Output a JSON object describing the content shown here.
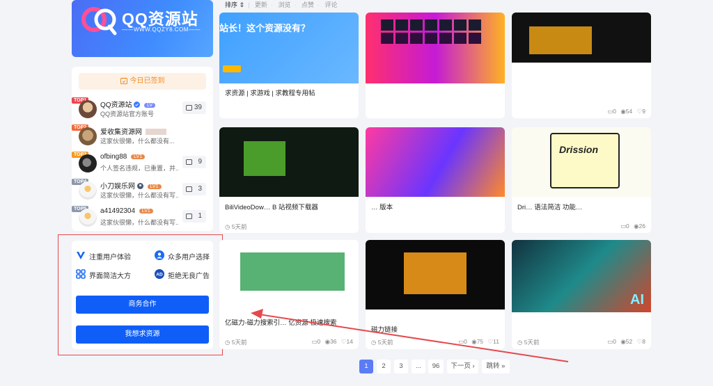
{
  "logo": {
    "title": "QQ资源站",
    "subtitle": "WWW.QQZY8.COM"
  },
  "signin": {
    "label": "今日已签到"
  },
  "users": [
    {
      "rank": "TOP1",
      "name": "QQ资源站",
      "level": "LV",
      "desc": "QQ资源站官方账号",
      "count": "39",
      "rank_color": "#f0444f"
    },
    {
      "rank": "TOP2",
      "name": "爱收集资源网",
      "level": "",
      "desc": "这家伙很懒，什么都没有...",
      "count": "",
      "rank_color": "#f26b3a"
    },
    {
      "rank": "TOP3",
      "name": "ofbing88",
      "level": "LV1",
      "desc": "个人签名违规，已重置，并...",
      "count": "9",
      "rank_color": "#f59a23"
    },
    {
      "rank": "TOP4",
      "name": "小刀娱乐网",
      "level": "LV1",
      "desc": "这家伙很懒，什么都没有写...",
      "count": "3",
      "rank_color": "#8e98ab"
    },
    {
      "rank": "TOP5",
      "name": "a41492304",
      "level": "LV1",
      "desc": "这家伙很懒，什么都没有写...",
      "count": "1",
      "rank_color": "#8e98ab"
    }
  ],
  "features": {
    "items": [
      "注重用户体验",
      "众多用户选择",
      "界面简洁大方",
      "拒绝无良广告"
    ],
    "business_btn": "商务合作",
    "request_btn": "我想求资源"
  },
  "sortbar": {
    "label": "排序",
    "options": [
      "更新",
      "浏览",
      "点赞",
      "评论"
    ]
  },
  "cards": [
    {
      "title": "求资源 | 求游戏 | 求教程专用帖",
      "time": "",
      "comments": "",
      "views": "",
      "likes": "",
      "thumb_text": "站长！这个资源没有？"
    },
    {
      "title": "",
      "time": "",
      "comments": "",
      "views": "",
      "likes": "",
      "thumb_text": ""
    },
    {
      "title": "",
      "time": "",
      "comments": "0",
      "views": "54",
      "likes": "9",
      "thumb_text": ""
    },
    {
      "title": "BiliVideoDow… B 站视频下载器",
      "time": "5天前",
      "comments": "",
      "views": "",
      "likes": "",
      "thumb_text": ""
    },
    {
      "title": "… 版本",
      "time": "",
      "comments": "",
      "views": "",
      "likes": "",
      "thumb_text": ""
    },
    {
      "title": "Dri… 语法简洁 功能…",
      "time": "",
      "comments": "0",
      "views": "26",
      "likes": "",
      "thumb_text": "Drission"
    },
    {
      "title": "亿磁力-磁力搜索引… 亿资源 极速搜索",
      "time": "5天前",
      "comments": "0",
      "views": "36",
      "likes": "14",
      "thumb_text": ""
    },
    {
      "title": "磁力链接",
      "time": "5天前",
      "comments": "0",
      "views": "75",
      "likes": "11",
      "thumb_text": ""
    },
    {
      "title": "",
      "time": "5天前",
      "comments": "0",
      "views": "52",
      "likes": "8",
      "thumb_text": ""
    }
  ],
  "pagination": {
    "pages": [
      "1",
      "2",
      "3",
      "...",
      "96"
    ],
    "next": "下一页",
    "jump": "跳转"
  },
  "colors": {
    "accent": "#0f5ef7",
    "page_active": "#5b7cf6",
    "annotation": "#e5484d"
  }
}
